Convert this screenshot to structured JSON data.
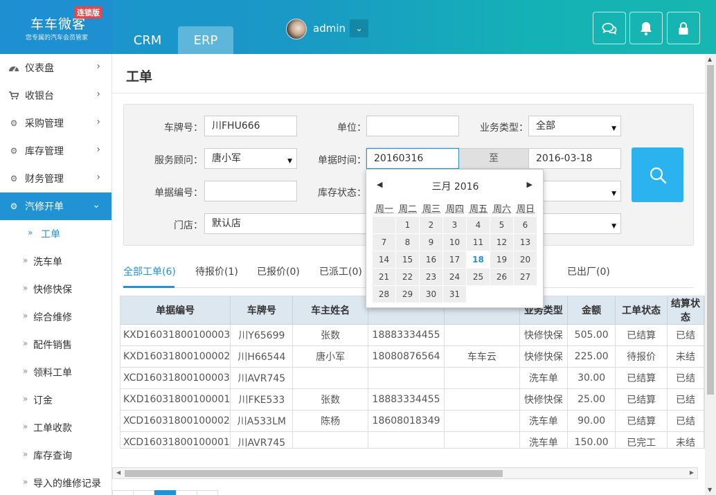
{
  "logo": {
    "name": "车车微客",
    "badge": "连锁版",
    "subtitle": "您专属的汽车会员管家"
  },
  "header": {
    "tabs": [
      {
        "label": "CRM"
      },
      {
        "label": "ERP"
      }
    ],
    "user": {
      "name": "admin"
    },
    "icons": [
      "chat-icon",
      "bell-icon",
      "lock-icon"
    ]
  },
  "sidebar": {
    "items": [
      {
        "label": "仪表盘",
        "icon": "dashboard-icon"
      },
      {
        "label": "收银台",
        "icon": "cart-icon"
      },
      {
        "label": "采购管理",
        "icon": "gears-icon"
      },
      {
        "label": "库存管理",
        "icon": "gears-icon"
      },
      {
        "label": "财务管理",
        "icon": "gears-icon"
      },
      {
        "label": "汽修开单",
        "icon": "gears-icon"
      }
    ],
    "subitems": [
      {
        "label": "工单"
      },
      {
        "label": "洗车单"
      },
      {
        "label": "快修快保"
      },
      {
        "label": "综合维修"
      },
      {
        "label": "配件销售"
      },
      {
        "label": "领料工单"
      },
      {
        "label": "订金"
      },
      {
        "label": "工单收款"
      },
      {
        "label": "库存查询"
      },
      {
        "label": "导入的维修记录"
      }
    ]
  },
  "page": {
    "title": "工单"
  },
  "filter": {
    "plate_label": "车牌号：",
    "plate_value": "川FHU666",
    "unit_label": "单位：",
    "unit_value": "",
    "biztype_label": "业务类型：",
    "biztype_value": "全部",
    "advisor_label": "服务顾问：",
    "advisor_value": "唐小军",
    "date_label": "单据时间：",
    "date_from": "20160316",
    "date_sep": "至",
    "date_to": "2016-03-18",
    "docno_label": "单据编号：",
    "docno_value": "",
    "stock_label": "库存状态：",
    "stock_value": "",
    "store_label": "门店：",
    "store_value": "默认店"
  },
  "datepicker": {
    "month": "三月 2016",
    "weekdays": [
      "周一",
      "周二",
      "周三",
      "周四",
      "周五",
      "周六",
      "周日"
    ],
    "today": 18
  },
  "tabs": [
    {
      "label": "全部工单(6)"
    },
    {
      "label": "待报价(1)"
    },
    {
      "label": "已报价(0)"
    },
    {
      "label": "已派工(0)"
    },
    {
      "label": ""
    },
    {
      "label": "已出厂(0)"
    }
  ],
  "table": {
    "headers": [
      "单据编号",
      "车牌号",
      "车主姓名",
      "",
      "",
      "业务类型",
      "金额",
      "工单状态",
      "结算状态"
    ],
    "rows": [
      [
        "KXD16031800100003",
        "川Y65699",
        "张数",
        "18883334455",
        "",
        "快修快保",
        "505.00",
        "已结算",
        "已结"
      ],
      [
        "KXD16031800100002",
        "川H66544",
        "唐小军",
        "18080876564",
        "车车云",
        "快修快保",
        "225.00",
        "待报价",
        "未结"
      ],
      [
        "XCD16031800100003",
        "川AVR745",
        "",
        "",
        "",
        "洗车单",
        "30.00",
        "已结算",
        "已结"
      ],
      [
        "KXD16031800100001",
        "川FKE533",
        "张数",
        "18883334455",
        "",
        "快修快保",
        "25.00",
        "已结算",
        "已结"
      ],
      [
        "XCD16031800100002",
        "川A533LM",
        "陈杨",
        "18608018349",
        "",
        "洗车单",
        "90.00",
        "已结算",
        "已结"
      ],
      [
        "XCD16031800100001",
        "川AVR745",
        "",
        "",
        "",
        "洗车单",
        "150.00",
        "已完工",
        "未结"
      ]
    ]
  }
}
